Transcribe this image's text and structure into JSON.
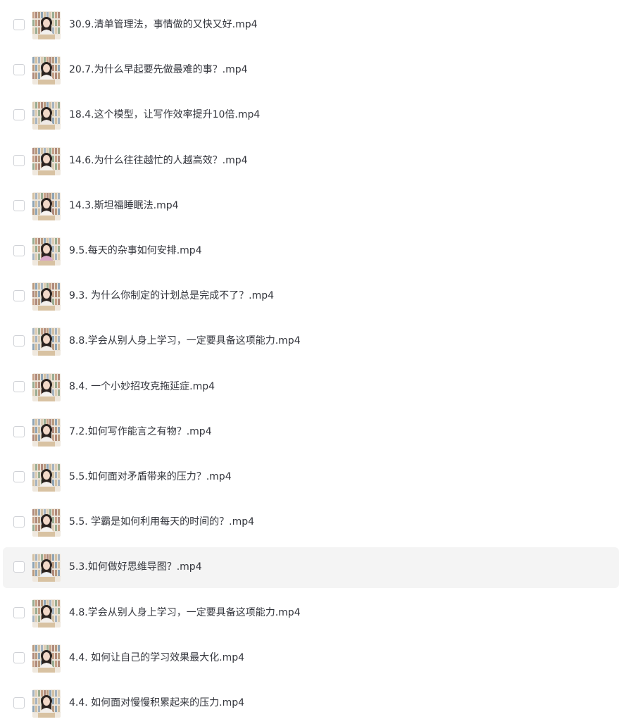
{
  "files": [
    {
      "name": "30.9.清单管理法，事情做的又快又好.mp4",
      "highlighted": false
    },
    {
      "name": "20.7.为什么早起要先做最难的事？.mp4",
      "highlighted": false
    },
    {
      "name": "18.4.这个模型，让写作效率提升10倍.mp4",
      "highlighted": false
    },
    {
      "name": "14.6.为什么往往越忙的人越高效？.mp4",
      "highlighted": false
    },
    {
      "name": "14.3.斯坦福睡眠法.mp4",
      "highlighted": false
    },
    {
      "name": "9.5.每天的杂事如何安排.mp4",
      "highlighted": false
    },
    {
      "name": "9.3. 为什么你制定的计划总是完成不了？.mp4",
      "highlighted": false
    },
    {
      "name": "8.8.学会从别人身上学习，一定要具备这项能力.mp4",
      "highlighted": false
    },
    {
      "name": "8.4. 一个小妙招攻克拖延症.mp4",
      "highlighted": false
    },
    {
      "name": "7.2.如何写作能言之有物？.mp4",
      "highlighted": false
    },
    {
      "name": "5.5.如何面对矛盾带来的压力？.mp4",
      "highlighted": false
    },
    {
      "name": "5.5. 学霸是如何利用每天的时间的？.mp4",
      "highlighted": false
    },
    {
      "name": "5.3.如何做好思维导图？.mp4",
      "highlighted": true
    },
    {
      "name": "4.8.学会从别人身上学习，一定要具备这项能力.mp4",
      "highlighted": false
    },
    {
      "name": "4.4. 如何让自己的学习效果最大化.mp4",
      "highlighted": false
    },
    {
      "name": "4.4. 如何面对慢慢积累起来的压力.mp4",
      "highlighted": false
    }
  ],
  "thumbnail_icon": "video-thumbnail-presenter",
  "colors": {
    "text": "#33353c",
    "checkbox_border": "#cfd1d6",
    "row_highlight": "#f4f4f4"
  }
}
